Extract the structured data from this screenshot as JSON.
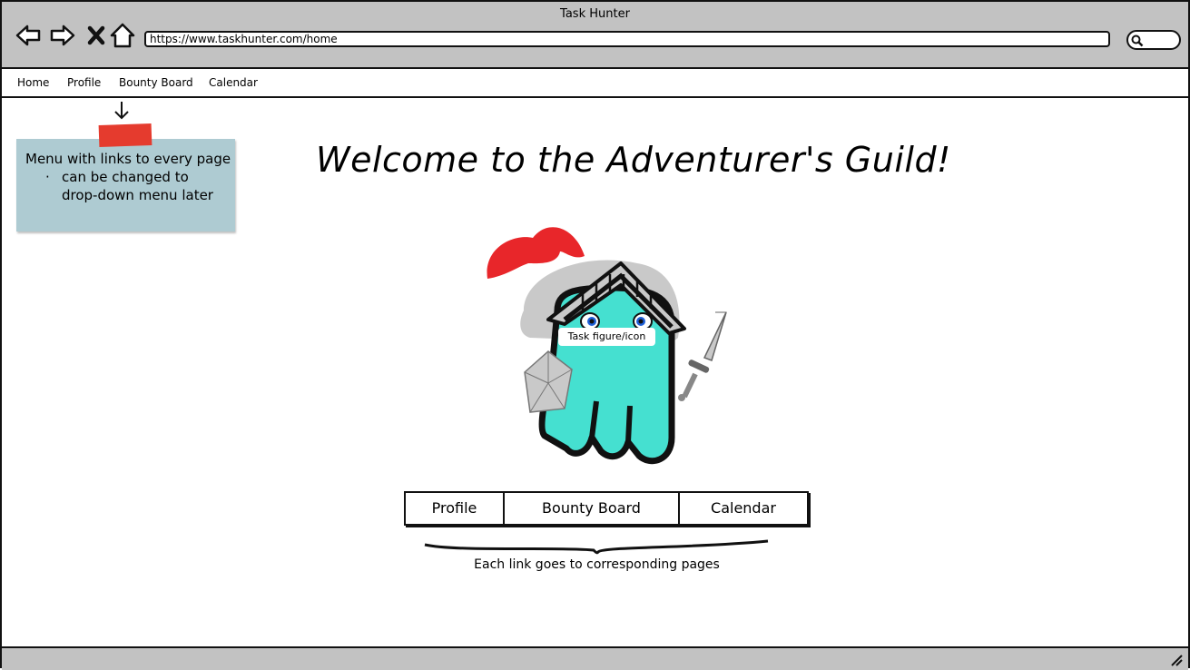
{
  "window": {
    "title": "Task Hunter"
  },
  "browser": {
    "url": "https://www.taskhunter.com/home"
  },
  "icons": {
    "back": "arrow-left-icon",
    "forward": "arrow-right-icon",
    "stop": "close-icon",
    "home": "home-icon",
    "search": "search-icon",
    "resize": "resize-grip-icon"
  },
  "menu": {
    "items": [
      "Home",
      "Profile",
      "Bounty Board",
      "Calendar"
    ]
  },
  "note": {
    "line1": "Menu with links to every page",
    "bullet": "·",
    "line2": "can be changed to",
    "line3": "drop-down menu later"
  },
  "main": {
    "heading": "Welcome to the Adventurer's Guild!",
    "figure_label": "Task figure/icon",
    "buttons": [
      "Profile",
      "Bounty Board",
      "Calendar"
    ],
    "caption": "Each link goes to corresponding pages"
  },
  "colors": {
    "chrome": "#c2c2c2",
    "note": "#aecbd2",
    "tape": "#e53b2e",
    "mascot": "#45e0d0",
    "plume": "#e8262a"
  }
}
